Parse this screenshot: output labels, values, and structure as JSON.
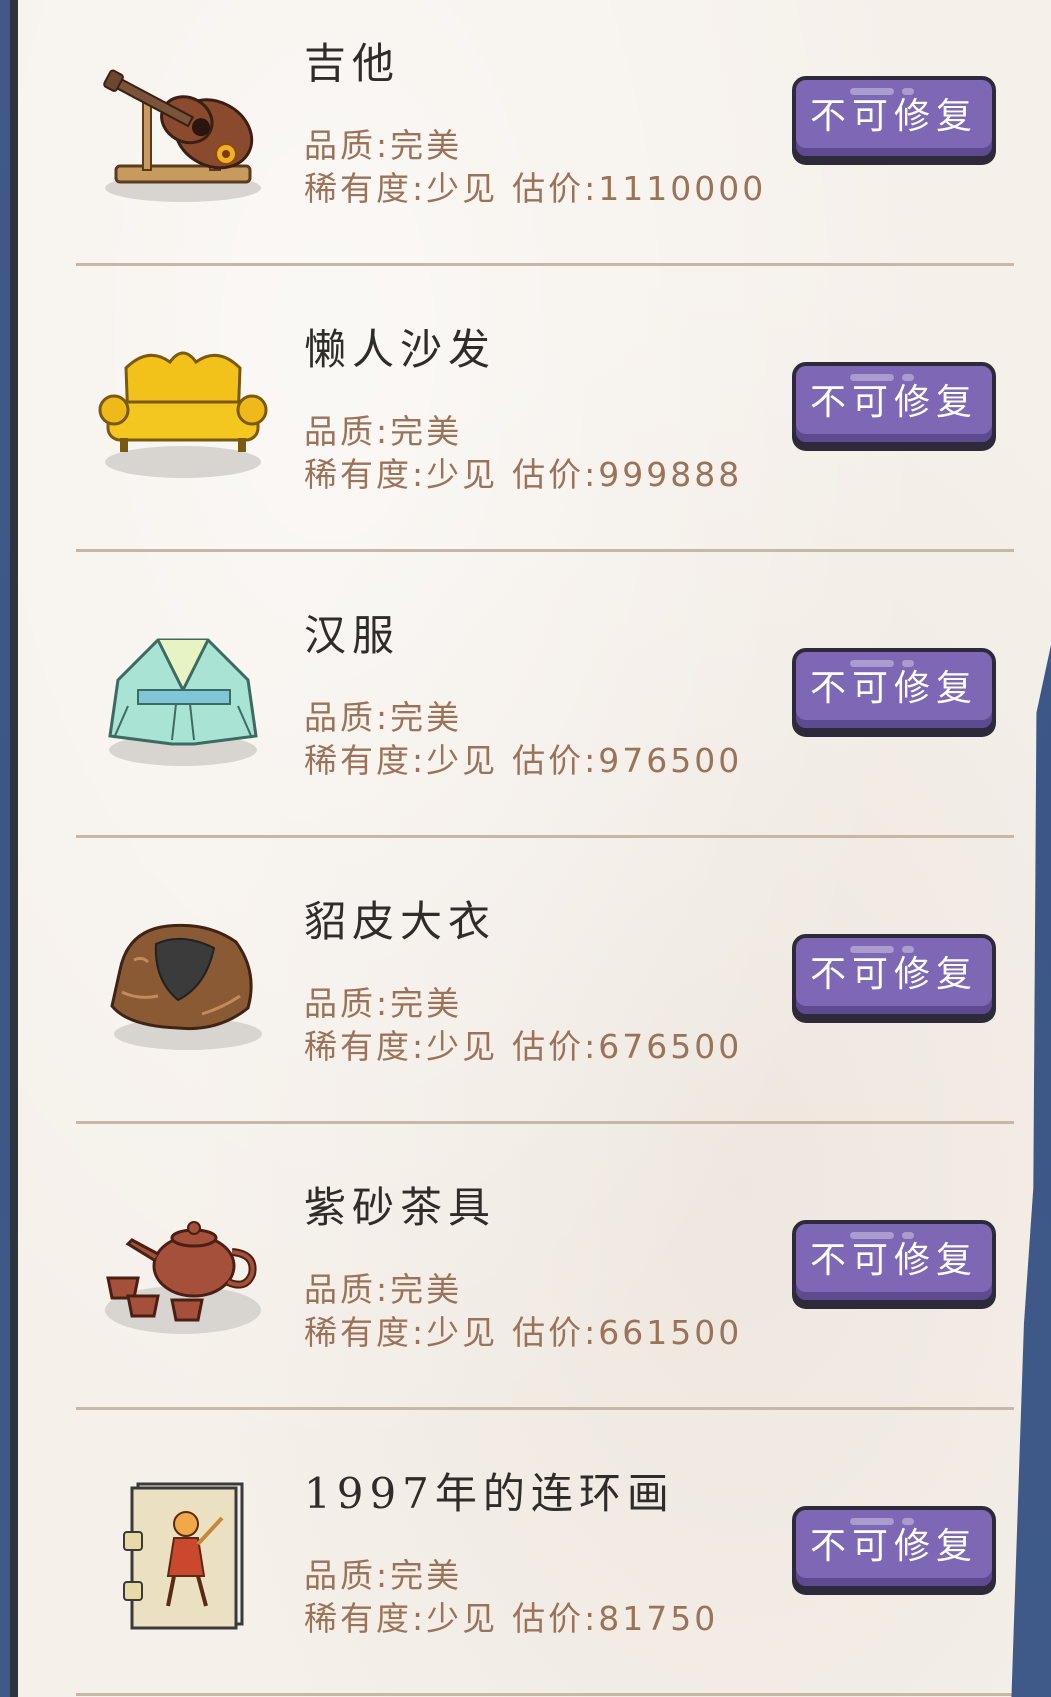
{
  "labels": {
    "quality_prefix": "品质:",
    "rarity_prefix": "稀有度:",
    "price_prefix": "估价:"
  },
  "items": [
    {
      "name": "吉他",
      "icon": "guitar-icon",
      "quality": "完美",
      "rarity": "少见",
      "price": "1110000",
      "action": "不可修复"
    },
    {
      "name": "懒人沙发",
      "icon": "sofa-icon",
      "quality": "完美",
      "rarity": "少见",
      "price": "999888",
      "action": "不可修复"
    },
    {
      "name": "汉服",
      "icon": "hanfu-icon",
      "quality": "完美",
      "rarity": "少见",
      "price": "976500",
      "action": "不可修复"
    },
    {
      "name": "貂皮大衣",
      "icon": "fur-coat-icon",
      "quality": "完美",
      "rarity": "少见",
      "price": "676500",
      "action": "不可修复"
    },
    {
      "name": "紫砂茶具",
      "icon": "teapot-icon",
      "quality": "完美",
      "rarity": "少见",
      "price": "661500",
      "action": "不可修复"
    },
    {
      "name": "1997年的连环画",
      "icon": "comic-book-icon",
      "quality": "完美",
      "rarity": "少见",
      "price": "81750",
      "action": "不可修复"
    }
  ],
  "colors": {
    "button": "#7e67b4",
    "button_shadow": "#5d4a90",
    "meta_text": "#9b7359",
    "name_text": "#2f2c2a",
    "divider": "#c7b7a7",
    "background_edge": "#3f5a86"
  }
}
